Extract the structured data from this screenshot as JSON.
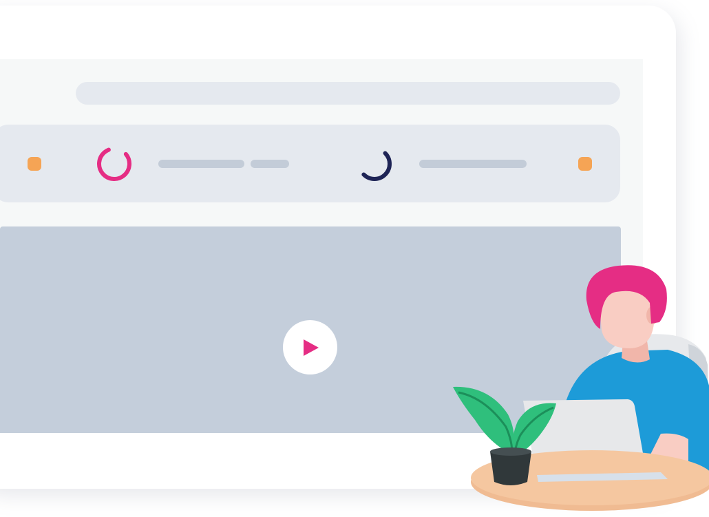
{
  "colors": {
    "accent_pink": "#e52d84",
    "accent_navy": "#1e2456",
    "status_orange": "#f5a455",
    "placeholder_gray": "#c3ccd8",
    "video_bg": "#c4cedb",
    "panel_bg": "#e5e9ef"
  },
  "icons": {
    "left_status": "orange-dot-icon",
    "left_spinner": "pink-progress-ring-icon",
    "right_spinner": "navy-progress-ring-icon",
    "right_status": "orange-dot-icon",
    "play": "play-icon"
  },
  "progress": {
    "pink_ring": 0.8,
    "navy_ring": 0.5
  }
}
